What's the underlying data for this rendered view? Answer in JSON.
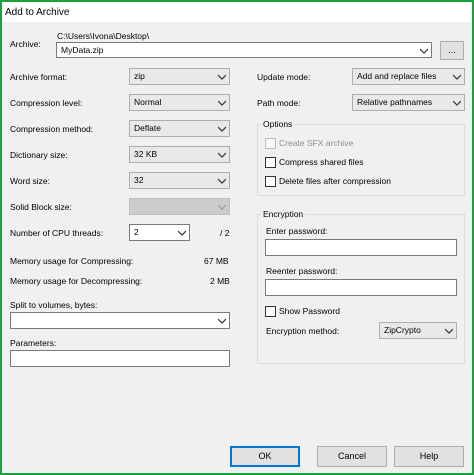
{
  "window": {
    "title": "Add to Archive"
  },
  "archive": {
    "label": "Archive:",
    "path": "C:\\Users\\Ivona\\Desktop\\",
    "filename": "MyData.zip",
    "browse_label": "..."
  },
  "left": {
    "archive_format": {
      "label": "Archive format:",
      "value": "zip"
    },
    "compression_level": {
      "label": "Compression level:",
      "value": "Normal"
    },
    "compression_method": {
      "label": "Compression method:",
      "value": "Deflate"
    },
    "dictionary_size": {
      "label": "Dictionary size:",
      "value": "32 KB"
    },
    "word_size": {
      "label": "Word size:",
      "value": "32"
    },
    "solid_block": {
      "label": "Solid Block size:",
      "value": ""
    },
    "cpu_threads": {
      "label": "Number of CPU threads:",
      "value": "2",
      "max": "/ 2"
    },
    "mem_compress": {
      "label": "Memory usage for Compressing:",
      "value": "67 MB"
    },
    "mem_decompress": {
      "label": "Memory usage for Decompressing:",
      "value": "2 MB"
    },
    "split": {
      "label": "Split to volumes, bytes:",
      "value": ""
    },
    "parameters": {
      "label": "Parameters:",
      "value": ""
    }
  },
  "right": {
    "update_mode": {
      "label": "Update mode:",
      "value": "Add and replace files"
    },
    "path_mode": {
      "label": "Path mode:",
      "value": "Relative pathnames"
    },
    "options": {
      "title": "Options",
      "create_sfx": "Create SFX archive",
      "compress_shared": "Compress shared files",
      "delete_after": "Delete files after compression"
    },
    "encryption": {
      "title": "Encryption",
      "enter_password": "Enter password:",
      "reenter_password": "Reenter password:",
      "show_password": "Show Password",
      "method_label": "Encryption method:",
      "method_value": "ZipCrypto"
    }
  },
  "buttons": {
    "ok": "OK",
    "cancel": "Cancel",
    "help": "Help"
  },
  "colors": {
    "window_border": "#1aa33a",
    "focus_border": "#0078d7",
    "dialog_bg": "#f0f0f0"
  }
}
